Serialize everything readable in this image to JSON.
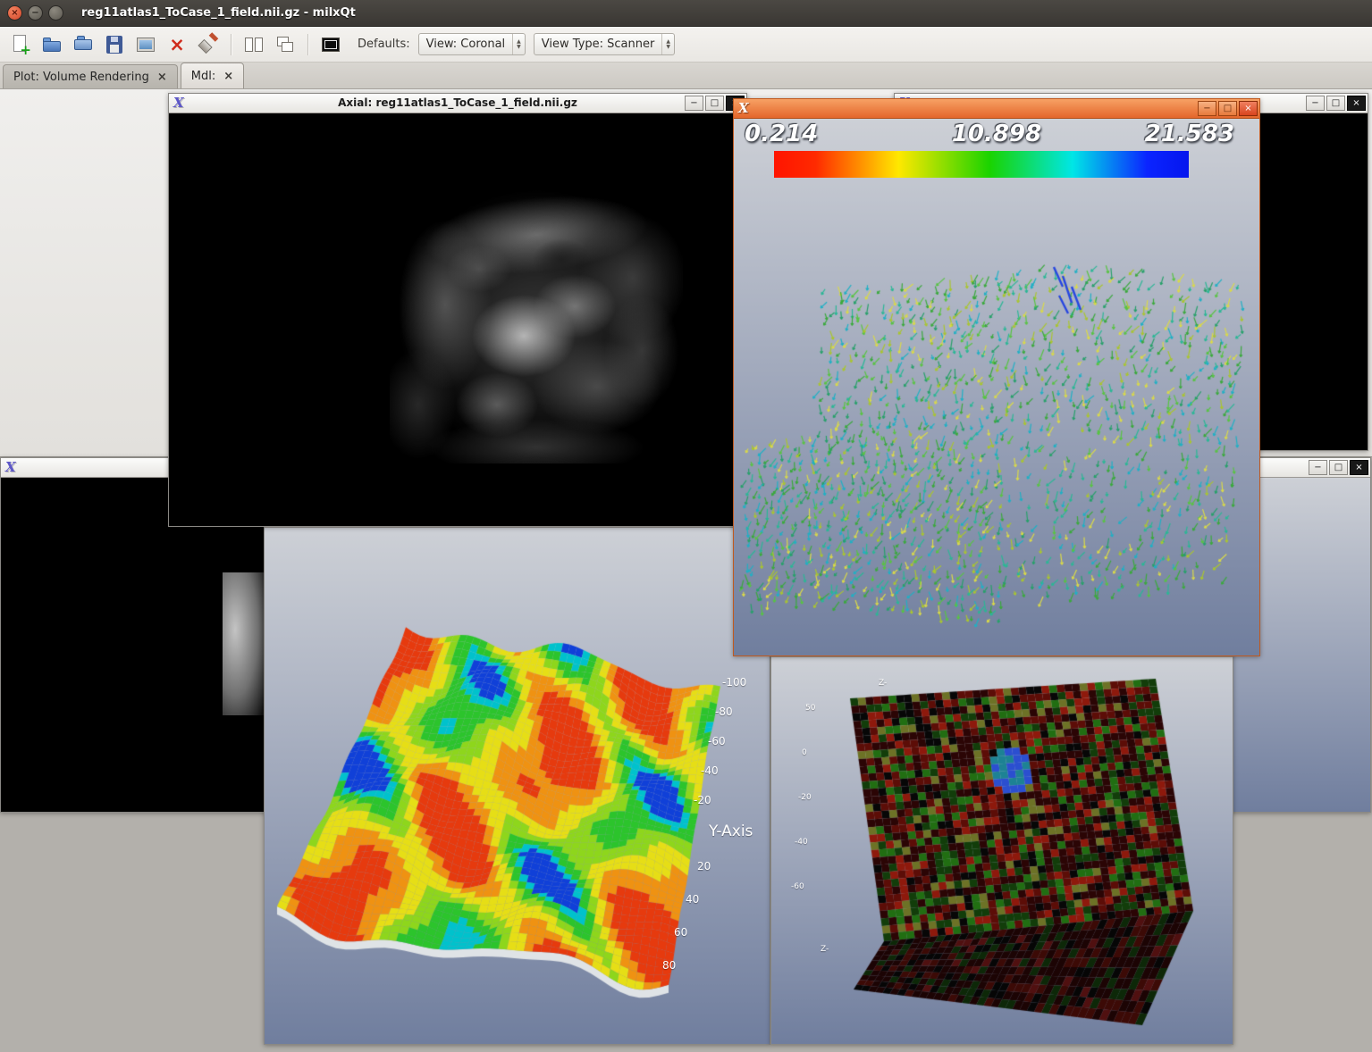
{
  "titlebar": {
    "title": "reg11atlas1_ToCase_1_field.nii.gz - milxQt"
  },
  "toolbar": {
    "defaults_label": "Defaults:",
    "view_combo_value": "View: Coronal",
    "view_type_combo_value": "View Type: Scanner"
  },
  "tabs": [
    {
      "label": "Plot: Volume Rendering"
    },
    {
      "label": "Mdl:"
    }
  ],
  "windows": {
    "axial": {
      "title": "Axial: reg11atlas1_ToCase_1_field.nii.gz",
      "logo": "X"
    },
    "vector": {
      "logo": "X",
      "colorbar": {
        "min_label": "0.214",
        "mid_label": "10.898",
        "max_label": "21.583",
        "gradient_stops": [
          "#ff1400 0%",
          "#ff2a00 10%",
          "#ffe800 30%",
          "#1ad300 52%",
          "#00e6e6 72%",
          "#0b24ff 90%",
          "#0516ee 100%"
        ]
      }
    },
    "surface": {
      "y_axis_label": "Y-Axis",
      "ticks_upper": [
        "-100",
        "-80",
        "-60",
        "-40",
        "-20"
      ],
      "ticks_lower": [
        "20",
        "40",
        "60",
        "80"
      ]
    },
    "model": {
      "axis_label_top": "Z-",
      "axis_label_bottom": "Z-",
      "ticks": [
        "50",
        "0",
        "-20",
        "-40",
        "-60"
      ]
    },
    "hidden": {
      "logo": "X"
    }
  },
  "glyphs": {
    "x": "×",
    "minus": "−",
    "square": "□",
    "plus": "+",
    "up": "▲",
    "down": "▼"
  }
}
